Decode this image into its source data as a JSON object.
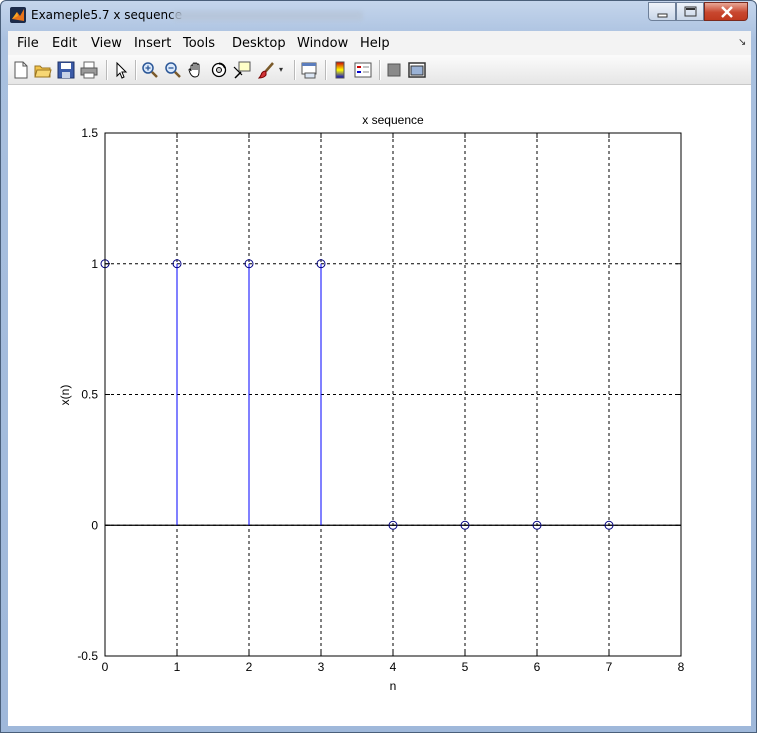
{
  "window": {
    "title": "Exameple5.7 x sequence",
    "title_bar_color": "#a9c0df"
  },
  "menu": {
    "items": [
      "File",
      "Edit",
      "View",
      "Insert",
      "Tools",
      "Desktop",
      "Window",
      "Help"
    ]
  },
  "toolbar": {
    "icons": [
      "new-figure-icon",
      "open-file-icon",
      "save-icon",
      "print-icon",
      "pointer-icon",
      "zoom-in-icon",
      "zoom-out-icon",
      "pan-icon",
      "rotate-3d-icon",
      "data-cursor-icon",
      "brush-icon",
      "link-plot-icon",
      "colorbar-icon",
      "legend-icon",
      "hide-plot-tools-icon",
      "show-plot-tools-icon"
    ]
  },
  "chart_data": {
    "type": "stem",
    "title": "x sequence",
    "xlabel": "n",
    "ylabel": "x(n)",
    "x": [
      0,
      1,
      2,
      3,
      4,
      5,
      6,
      7
    ],
    "values": [
      1,
      1,
      1,
      1,
      0,
      0,
      0,
      0
    ],
    "xlim": [
      0,
      8
    ],
    "ylim": [
      -0.5,
      1.5
    ],
    "xticks": [
      "0",
      "1",
      "2",
      "3",
      "4",
      "5",
      "6",
      "7",
      "8"
    ],
    "yticks": [
      "-0.5",
      "0",
      "0.5",
      "1",
      "1.5"
    ],
    "grid": true,
    "colors": {
      "stem": "#0000ff",
      "marker": "#000080",
      "zero_line": "#000000"
    }
  }
}
